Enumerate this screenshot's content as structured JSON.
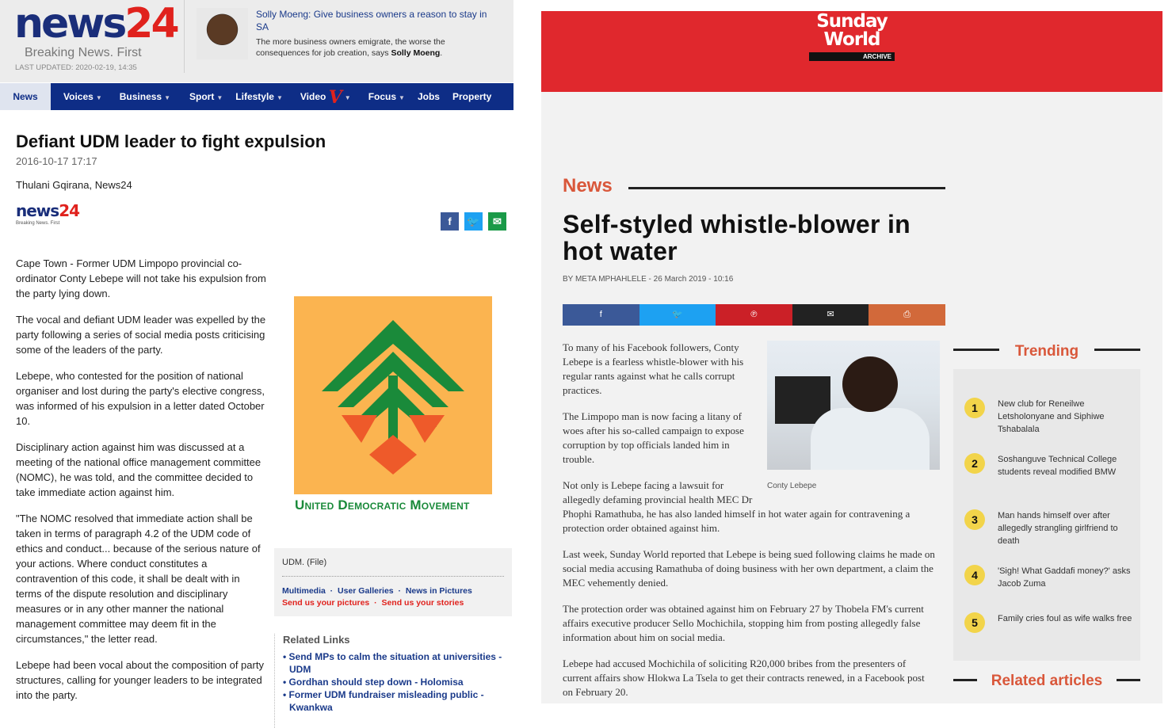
{
  "news24": {
    "logo_news": "news",
    "logo_24": "24",
    "tagline": "Breaking News. First",
    "last_updated": "LAST UPDATED: 2020-02-19, 14:35",
    "promo": {
      "title": "Solly Moeng: Give business owners a reason to stay in SA",
      "desc": "The more business owners emigrate, the worse the consequences for job creation, says",
      "desc_bold": "Solly Moeng"
    },
    "nav": [
      "News",
      "Voices",
      "Business",
      "Sport",
      "Lifestyle",
      "Video",
      "Focus",
      "Jobs",
      "Property"
    ],
    "article": {
      "title": "Defiant UDM leader to fight expulsion",
      "date": "2016-10-17 17:17",
      "author": "Thulani Gqirana, News24",
      "small_logo_news": "news",
      "small_logo_24": "24",
      "small_tag": "Breaking News. First",
      "paragraphs": [
        "Cape Town - Former UDM Limpopo provincial co-ordinator Conty Lebepe will not take his expulsion from the party lying down.",
        "The vocal and defiant UDM leader was expelled by the party following a series of social media posts criticising some of the leaders of the party.",
        "Lebepe, who contested for the position of national organiser and lost during the party's elective congress, was informed of his expulsion in a letter dated October 10.",
        "Disciplinary action against him was discussed at a meeting of the national office management committee (NOMC), he was told, and the committee decided to take immediate action against him.",
        "\"The NOMC resolved that immediate action shall be taken in terms of paragraph 4.2 of the UDM code of ethics and conduct... because of the serious nature of your actions. Where conduct constitutes a contravention of this code, it shall be dealt with in terms of the dispute resolution and disciplinary measures or in any other manner the national management committee may deem fit in the circumstances,\" the letter read.",
        "Lebepe had been vocal about the composition of party structures, calling for younger leaders to be integrated into the party."
      ],
      "image_text": "United Democratic Movement",
      "caption": "UDM. (File)",
      "links1": [
        "Multimedia",
        "User Galleries",
        "News in Pictures"
      ],
      "links2": [
        "Send us your pictures",
        "Send us your stories"
      ],
      "related_title": "Related Links",
      "related": [
        "Send MPs to calm the situation at universities - UDM",
        "Gordhan should step down - Holomisa",
        "Former UDM fundraiser misleading public - Kwankwa"
      ]
    },
    "colors": {
      "nav": "#0e2d86",
      "red": "#e0221d",
      "udm_bg": "#fbb450",
      "udm_green": "#1a8a3a",
      "udm_orange": "#ee5a2a"
    }
  },
  "sundayworld": {
    "logo_line1": "Sunday",
    "logo_line2": "World",
    "logo_archive": "ARCHIVE",
    "section": "News",
    "title": "Self-styled whistle-blower in hot water",
    "byline": "BY META MPHAHLELE - 26 March 2019 - 10:16",
    "share": [
      {
        "icon": "f",
        "color": "#3b5998",
        "name": "facebook-icon"
      },
      {
        "icon": "🐦",
        "color": "#1da1f2",
        "name": "twitter-icon"
      },
      {
        "icon": "℗",
        "color": "#cb2027",
        "name": "pinterest-icon"
      },
      {
        "icon": "✉",
        "color": "#222222",
        "name": "email-icon"
      },
      {
        "icon": "⎙",
        "color": "#d2693a",
        "name": "print-icon"
      }
    ],
    "photo_caption": "Conty Lebepe",
    "paragraphs": [
      "To many of his Facebook followers, Conty Lebepe is a fearless whistle-blower with his regular rants against what he calls corrupt practices.",
      "The Limpopo man is now facing a litany of woes after his so-called campaign to expose corruption by top officials landed him in trouble.",
      "Not only is Lebepe facing a lawsuit for allegedly defaming provincial health MEC Dr Phophi Ramathuba, he has also landed himself in hot water again for contravening a protection order obtained against him.",
      "Last week, Sunday World reported that Lebepe is being sued following claims he made on social media accusing Ramathuba of doing business with her own department, a claim the MEC vehemently denied.",
      "The protection order was obtained against him on February 27 by Thobela FM's current affairs executive producer Sello Mochichila, stopping him from posting allegedly false information about him on social media.",
      "Lebepe had accused Mochichila of soliciting R20,000 bribes from the presenters of current affairs show Hlokwa La Tsela to get their contracts renewed, in a Facebook post on February 20."
    ],
    "trending_title": "Trending",
    "trending": [
      {
        "num": "1",
        "text": "New club for Reneilwe Letsholonyane and Siphiwe Tshabalala"
      },
      {
        "num": "2",
        "text": "Soshanguve Technical College students reveal modified BMW"
      },
      {
        "num": "3",
        "text": "Man hands himself over after allegedly strangling girlfriend to death"
      },
      {
        "num": "4",
        "text": "'Sigh! What Gaddafi money?' asks Jacob Zuma"
      },
      {
        "num": "5",
        "text": "Family cries foul as wife walks free"
      }
    ],
    "related_title": "Related articles",
    "colors": {
      "header": "#e0282d",
      "accent": "#d9573a",
      "badge": "#f2d44a"
    }
  }
}
